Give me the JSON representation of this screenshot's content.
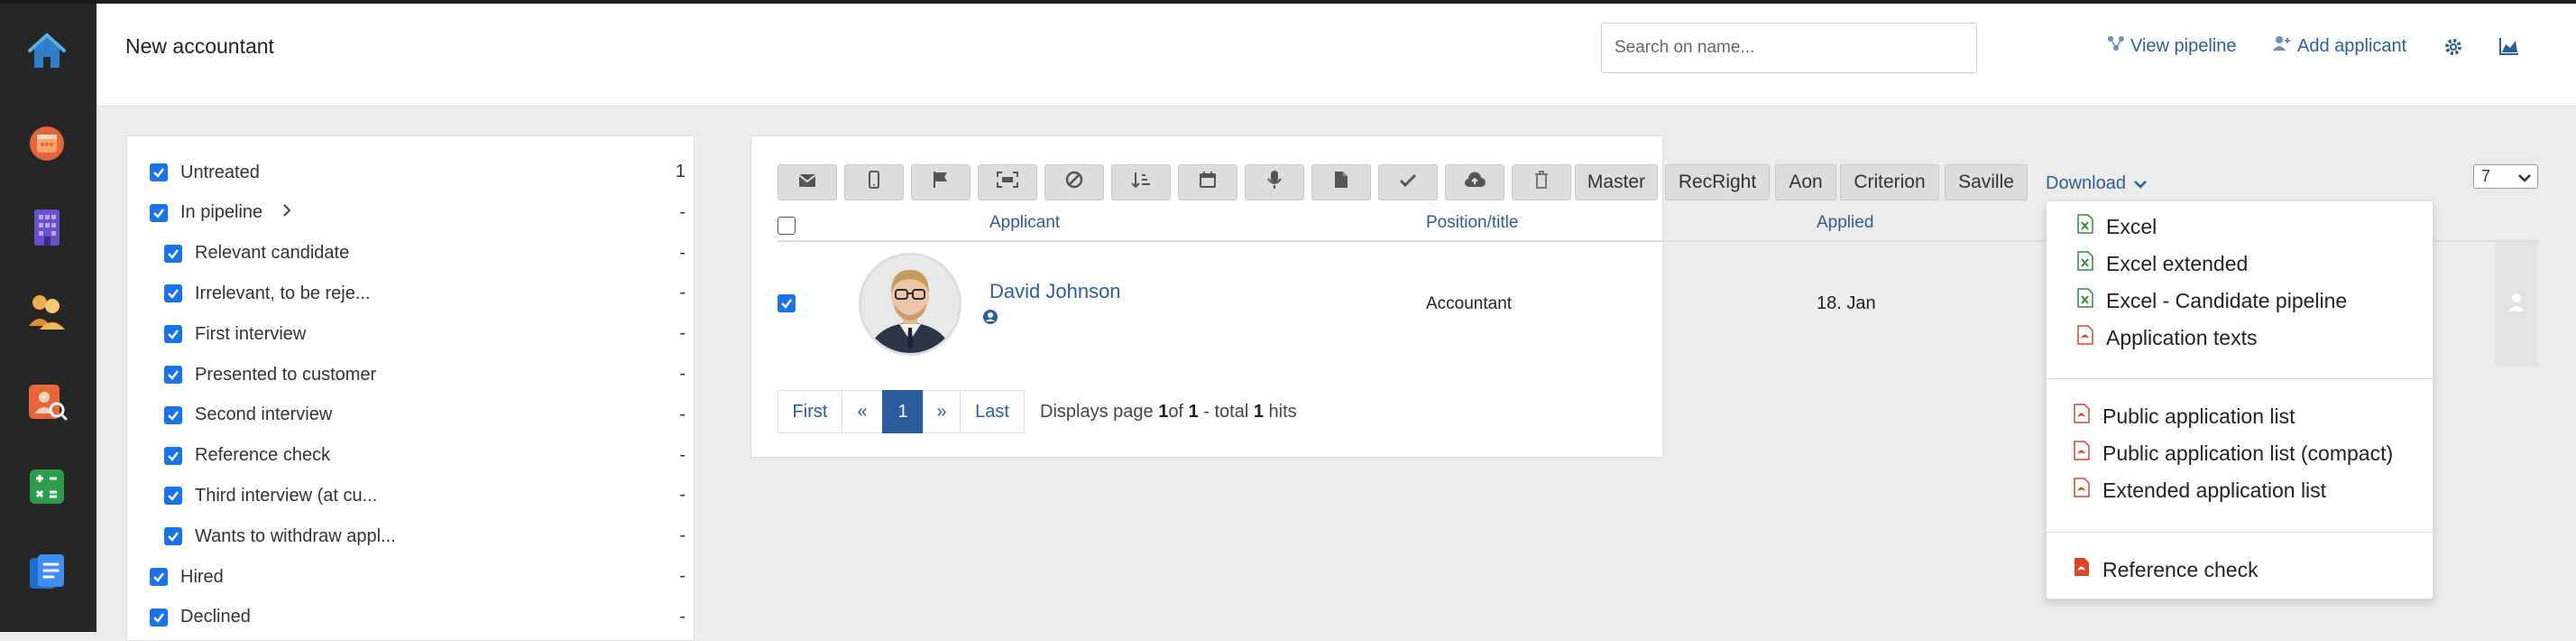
{
  "colors": {
    "accent": "#2d5d9a",
    "checkbox": "#1a73e8",
    "rail": "#262626",
    "excel": "#2e8b3a",
    "pdf": "#d9472b"
  },
  "rail": {
    "icons": [
      "home-icon",
      "calendar-icon",
      "building-icon",
      "people-icon",
      "candidate-search-icon",
      "calculator-icon",
      "documents-icon"
    ]
  },
  "header": {
    "title": "New accountant",
    "search_placeholder": "Search on name...",
    "view_pipeline": "View pipeline",
    "add_applicant": "Add applicant"
  },
  "filters": [
    {
      "label": "Untreated",
      "count": "1",
      "indent": false
    },
    {
      "label": "In pipeline",
      "count": "-",
      "indent": false,
      "expand": ">"
    },
    {
      "label": "Relevant candidate",
      "count": "-",
      "indent": true
    },
    {
      "label": "Irrelevant, to be reje...",
      "count": "-",
      "indent": true
    },
    {
      "label": "First interview",
      "count": "-",
      "indent": true
    },
    {
      "label": "Presented to customer",
      "count": "-",
      "indent": true
    },
    {
      "label": "Second interview",
      "count": "-",
      "indent": true
    },
    {
      "label": "Reference check",
      "count": "-",
      "indent": true
    },
    {
      "label": "Third interview (at cu...",
      "count": "-",
      "indent": true
    },
    {
      "label": "Wants to withdraw appl...",
      "count": "-",
      "indent": true
    },
    {
      "label": "Hired",
      "count": "-",
      "indent": false
    },
    {
      "label": "Declined",
      "count": "-",
      "indent": false
    }
  ],
  "toolbar": {
    "icon_buttons": [
      "email-icon",
      "mobile-icon",
      "flag-icon",
      "scan-icon",
      "block-icon",
      "sort-icon",
      "calendar-icon",
      "microphone-icon",
      "document-icon",
      "check-icon",
      "cloud-upload-icon",
      "trash-icon"
    ],
    "text_buttons": [
      "Master",
      "RecRight",
      "Aon",
      "Criterion",
      "Saville"
    ],
    "download_label": "Download",
    "per_page": "7"
  },
  "table": {
    "columns": [
      "Applicant",
      "Position/title",
      "Applied"
    ],
    "rows": [
      {
        "name": "David Johnson",
        "position": "Accountant",
        "applied": "18. Jan"
      }
    ]
  },
  "pagination": {
    "first": "First",
    "prev": "«",
    "current": "1",
    "next": "»",
    "last": "Last",
    "info_prefix": "Displays page ",
    "page": "1",
    "info_of": "of ",
    "total_pages": "1",
    "info_total": " - total ",
    "hits": "1",
    "info_suffix": " hits"
  },
  "download_menu": {
    "group1": [
      {
        "label": "Excel",
        "icon": "excel-icon"
      },
      {
        "label": "Excel extended",
        "icon": "excel-icon"
      },
      {
        "label": "Excel - Candidate pipeline",
        "icon": "excel-icon"
      },
      {
        "label": "Application texts",
        "icon": "pdf-icon"
      }
    ],
    "group2": [
      {
        "label": "Public application list",
        "icon": "pdf-icon"
      },
      {
        "label": "Public application list (compact)",
        "icon": "pdf-icon"
      },
      {
        "label": "Extended application list",
        "icon": "pdf-icon"
      }
    ],
    "group3": [
      {
        "label": "Reference check",
        "icon": "pdf-filled-icon"
      }
    ]
  }
}
